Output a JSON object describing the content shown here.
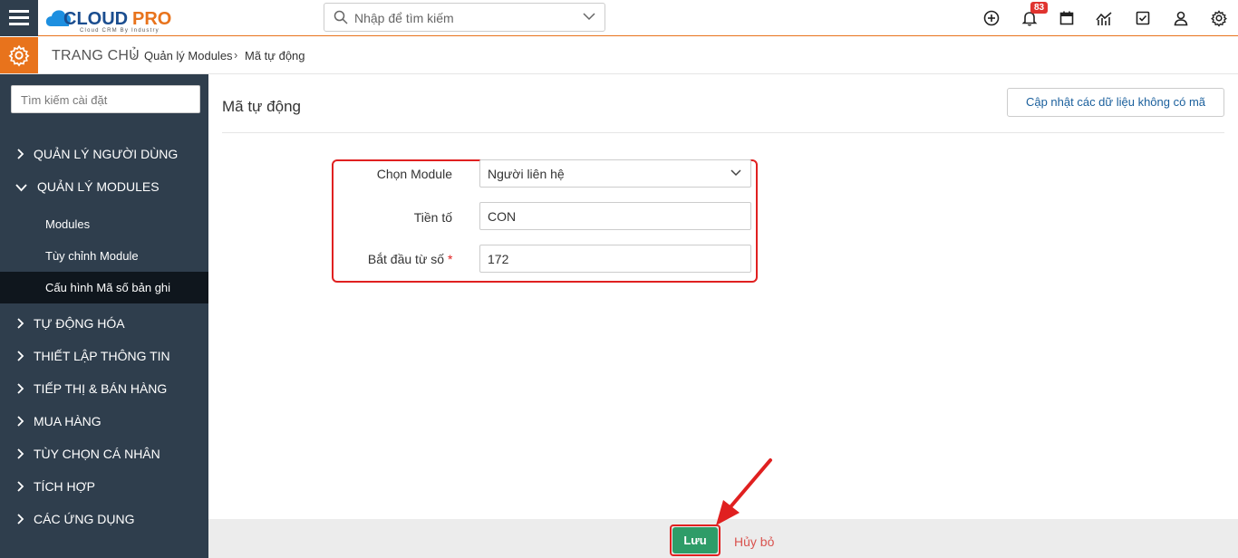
{
  "app": {
    "logo_text": "CLOUDPRO",
    "logo_tagline": "Cloud CRM By Industry"
  },
  "header": {
    "search_placeholder": "Nhập để tìm kiếm",
    "notification_count": "83",
    "icons": [
      "plus-circle-icon",
      "bell-icon",
      "calendar-icon",
      "chart-icon",
      "checkbox-icon",
      "user-icon",
      "gear-icon"
    ]
  },
  "breadcrumb": {
    "home": "TRANG CHỦ",
    "items": [
      "Quản lý Modules",
      "Mã tự động"
    ]
  },
  "sidebar": {
    "search_placeholder": "Tìm kiếm cài đặt",
    "sections": [
      {
        "label": "QUẢN LÝ NGƯỜI DÙNG",
        "expanded": false
      },
      {
        "label": "QUẢN LÝ MODULES",
        "expanded": true
      },
      {
        "label": "TỰ ĐỘNG HÓA",
        "expanded": false
      },
      {
        "label": "THIẾT LẬP THÔNG TIN",
        "expanded": false
      },
      {
        "label": "TIẾP THỊ & BÁN HÀNG",
        "expanded": false
      },
      {
        "label": "MUA HÀNG",
        "expanded": false
      },
      {
        "label": "TÙY CHỌN CÁ NHÂN",
        "expanded": false
      },
      {
        "label": "TÍCH HỢP",
        "expanded": false
      },
      {
        "label": "CÁC ỨNG DỤNG",
        "expanded": false
      }
    ],
    "subitems": [
      {
        "label": "Modules",
        "active": false
      },
      {
        "label": "Tùy chỉnh Module",
        "active": false
      },
      {
        "label": "Cấu hình Mã số bản ghi",
        "active": true
      }
    ]
  },
  "main": {
    "title": "Mã tự động",
    "update_button": "Cập nhật các dữ liệu không có mã",
    "form": {
      "module_label": "Chọn Module",
      "module_value": "Người liên hệ",
      "prefix_label": "Tiền tố",
      "prefix_value": "CON",
      "start_label": "Bắt đầu từ số",
      "start_required": "*",
      "start_value": "172"
    }
  },
  "footer": {
    "save_label": "Lưu",
    "cancel_label": "Hủy bỏ"
  },
  "colors": {
    "sidebar_bg": "#2f3e4d",
    "accent_orange": "#e8731c",
    "save_green": "#2e9c68",
    "highlight_red": "#e02020"
  }
}
